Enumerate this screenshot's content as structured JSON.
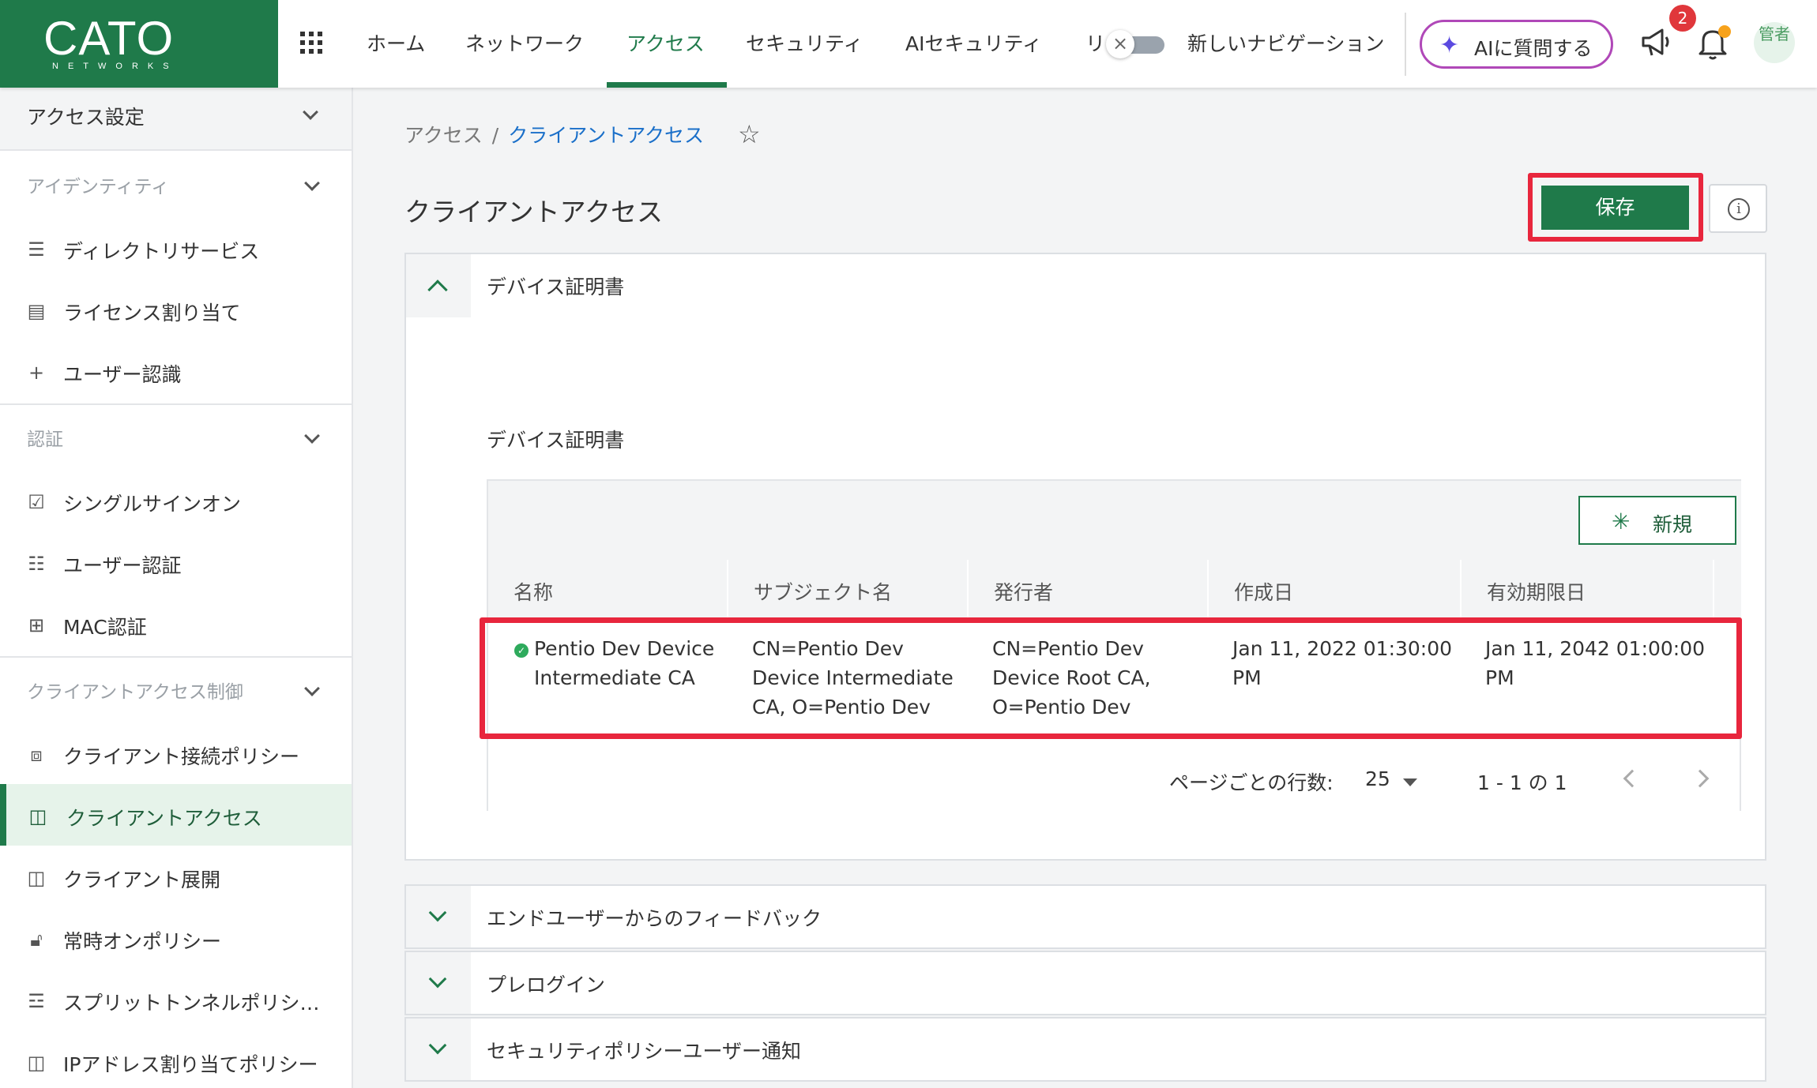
{
  "brand": {
    "name": "CATO",
    "sub": "NETWORKS"
  },
  "nav": {
    "items": [
      "ホーム",
      "ネットワーク",
      "アクセス",
      "セキュリティ",
      "AIセキュリティ",
      "リ"
    ],
    "new_nav_label": "新しいナビゲーション",
    "ai_button": "AIに質問する",
    "notification_count": "2",
    "avatar_text": "管者"
  },
  "sidebar": {
    "top": "アクセス設定",
    "sections": {
      "identity": "アイデンティティ",
      "auth": "認証",
      "client_access_control": "クライアントアクセス制御"
    },
    "items": {
      "directory": "ディレクトリサービス",
      "license": "ライセンス割り当て",
      "user_auth_plus": "ユーザー認識",
      "sso": "シングルサインオン",
      "user_auth": "ユーザー認証",
      "mac": "MAC認証",
      "client_conn_policy": "クライアント接続ポリシー",
      "client_access": "クライアントアクセス",
      "client_deploy": "クライアント展開",
      "always_on": "常時オンポリシー",
      "split_tunnel": "スプリットトンネルポリシ…",
      "ip_alloc": "IPアドレス割り当てポリシー"
    }
  },
  "breadcrumb": {
    "parent": "アクセス",
    "separator": "/",
    "current": "クライアントアクセス"
  },
  "page": {
    "title": "クライアントアクセス",
    "save": "保存"
  },
  "device_cert": {
    "panel_title": "デバイス証明書",
    "section_title": "デバイス証明書",
    "new_button": "新規",
    "columns": [
      "名称",
      "サブジェクト名",
      "発行者",
      "作成日",
      "有効期限日"
    ],
    "row": {
      "name": [
        "Pentio Dev Device",
        "Intermediate CA"
      ],
      "subject": [
        "CN=Pentio Dev",
        "Device Intermediate",
        "CA, O=Pentio Dev"
      ],
      "issuer": [
        "CN=Pentio Dev",
        "Device Root CA,",
        "O=Pentio Dev"
      ],
      "created": [
        "Jan 11, 2022 01:30:00",
        "PM"
      ],
      "expires": [
        "Jan 11, 2042 01:00:00",
        "PM"
      ]
    },
    "pager": {
      "rows_label": "ページごとの行数:",
      "rows_value": "25",
      "range": "1 - 1 の 1"
    }
  },
  "accordions": [
    "エンドユーザーからのフィードバック",
    "プレログイン",
    "セキュリティポリシーユーザー通知"
  ],
  "colors": {
    "brand": "#1f7a4a",
    "highlight": "#e8263d",
    "link": "#1a6fc9"
  }
}
